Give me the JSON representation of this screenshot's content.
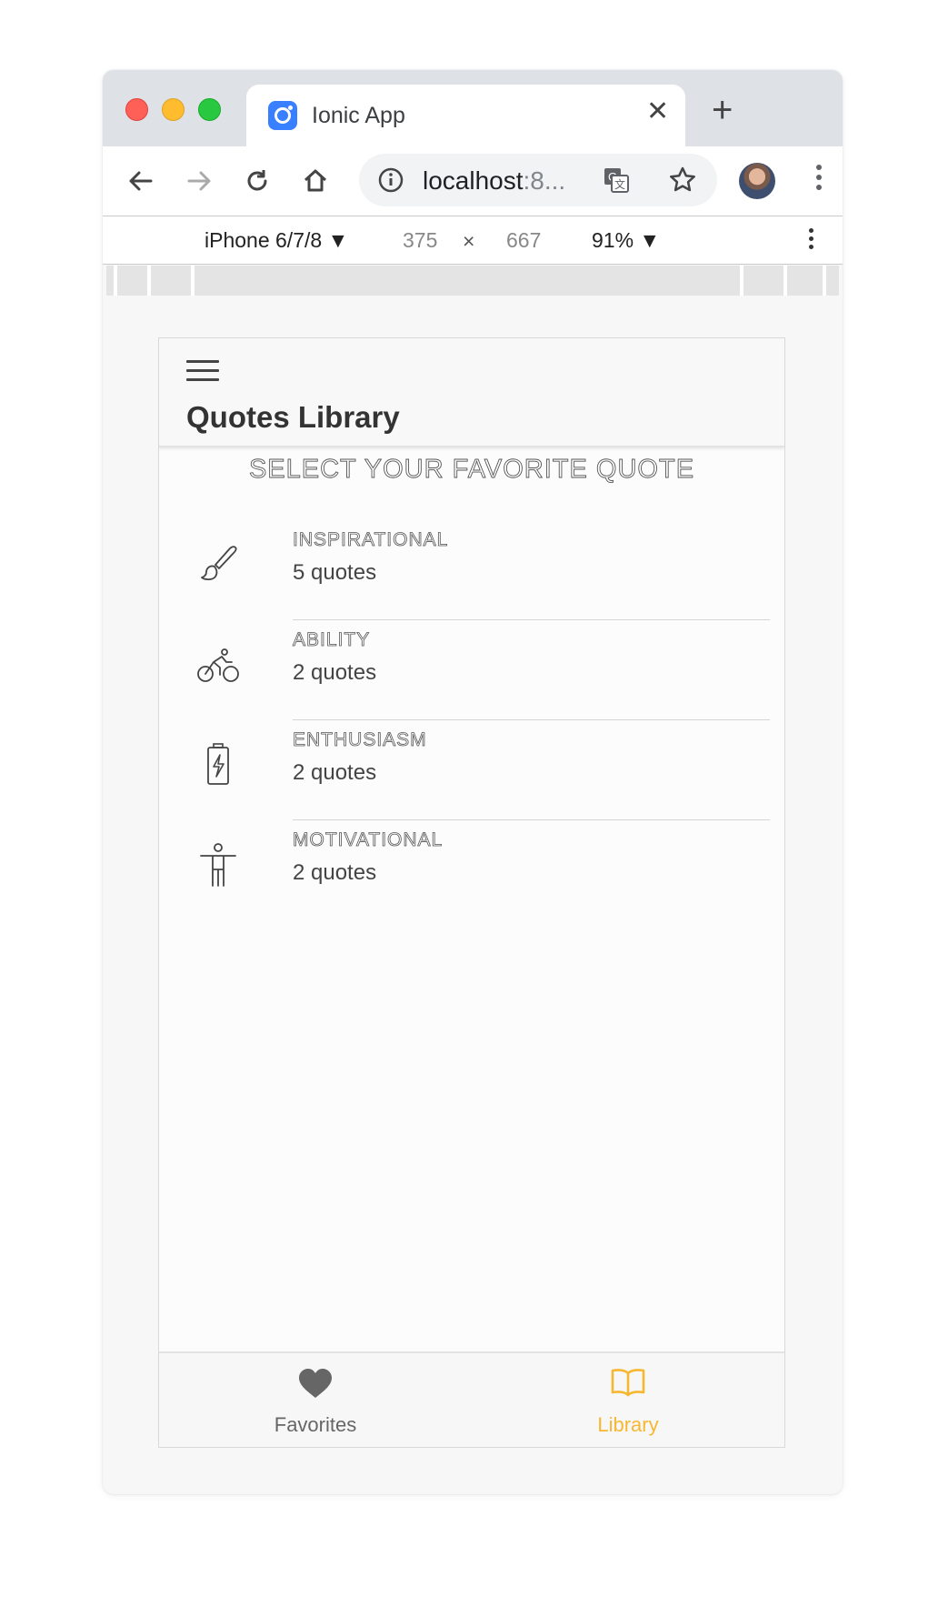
{
  "browser": {
    "tab_title": "Ionic App",
    "tab_close": "✕",
    "new_tab": "+",
    "url_host": "localhost",
    "url_port": ":8...",
    "icons": [
      "back-arrow-icon",
      "forward-arrow-icon",
      "reload-icon",
      "home-icon",
      "info-icon",
      "translate-icon",
      "star-icon",
      "avatar",
      "kebab-menu-icon"
    ]
  },
  "devtools": {
    "device": "iPhone 6/7/8 ▼",
    "width": "375",
    "times": "×",
    "height": "667",
    "zoom": "91% ▼"
  },
  "app": {
    "title": "Quotes Library",
    "subtitle": "SELECT YOUR FAVORITE QUOTE",
    "categories": [
      {
        "name": "INSPIRATIONAL",
        "count": "5 quotes",
        "icon": "brush-icon"
      },
      {
        "name": "ABILITY",
        "count": "2 quotes",
        "icon": "bicycle-icon"
      },
      {
        "name": "ENTHUSIASM",
        "count": "2 quotes",
        "icon": "battery-charging-icon"
      },
      {
        "name": "MOTIVATIONAL",
        "count": "2 quotes",
        "icon": "body-icon"
      }
    ],
    "tabs": [
      {
        "label": "Favorites",
        "icon": "heart-icon",
        "active": false
      },
      {
        "label": "Library",
        "icon": "book-icon",
        "active": true
      }
    ],
    "colors": {
      "active_tab": "#f7b731",
      "inactive_tab": "#666666"
    }
  }
}
